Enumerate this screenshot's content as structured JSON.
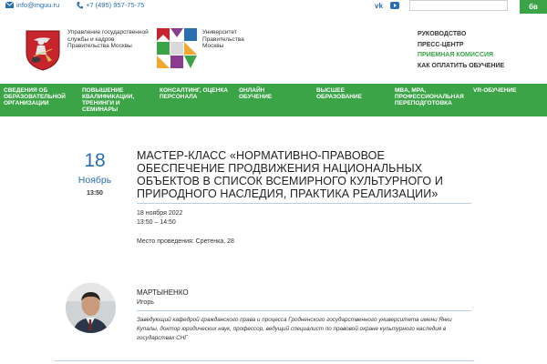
{
  "topbar": {
    "email": "info@mguu.ru",
    "phone": "+7 (495) 957-75-75",
    "search": {
      "placeholder": "",
      "value": ""
    },
    "lang_button": "бв"
  },
  "header": {
    "moscow_text": "Управление государственной службы и кадров Правительства Москвы",
    "mgu_text": "Университет Правительства Москвы",
    "links": [
      "РУКОВОДСТВО",
      "ПРЕСС-ЦЕНТР",
      "ПРИЕМНАЯ КОМИССИЯ",
      "КАК ОПЛАТИТЬ ОБУЧЕНИЕ"
    ]
  },
  "nav": {
    "items": [
      "СВЕДЕНИЯ ОБ ОБРАЗОВАТЕЛЬНОЙ ОРГАНИЗАЦИИ",
      "ПОВЫШЕНИЕ КВАЛИФИКАЦИИ, ТРЕНИНГИ И СЕМИНАРЫ",
      "КОНСАЛТИНГ, ОЦЕНКА ПЕРСОНАЛА",
      "ОНЛАЙН ОБУЧЕНИЕ",
      "ВЫСШЕЕ ОБРАЗОВАНИЕ",
      "MBA, MPA, ПРОФЕССИОНАЛЬНАЯ ПЕРЕПОДГОТОВКА",
      "VR-ОБУЧЕНИЕ"
    ]
  },
  "event": {
    "day": "18",
    "month": "Ноябрь",
    "time": "13:50",
    "title": "МАСТЕР-КЛАСС «НОРМАТИВНО-ПРАВОВОЕ ОБЕСПЕЧЕНИЕ ПРОДВИЖЕНИЯ НАЦИОНАЛЬНЫХ ОБЪЕКТОВ В СПИСОК ВСЕМИРНОГО КУЛЬТУРНОГО И ПРИРОДНОГО НАСЛЕДИЯ, ПРАКТИКА РЕАЛИЗАЦИИ»",
    "date_full": "18 ноября 2022",
    "hours": "13:50 – 14:50",
    "place": "Место проведения: Сретенка, 28"
  },
  "speaker": {
    "surname": "МАРТЫНЕНКО",
    "name": "Игорь",
    "bio": "Заведующий кафедрой гражданского права и процесса Гродненского государственного университета имени Янки Купалы, доктор юридических наук, профессор, ведущий специалист по правовой охране культурного наследия в государствах СНГ"
  },
  "colors": {
    "green": "#3aa447",
    "blue": "#2a6fb0"
  }
}
